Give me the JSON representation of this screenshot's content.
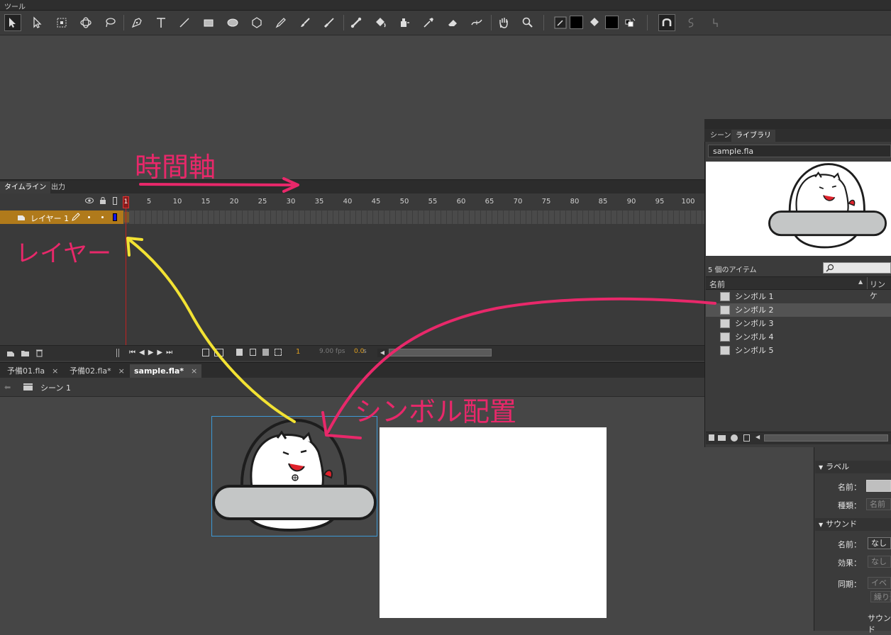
{
  "tools_panel": {
    "title": "ツール"
  },
  "timeline": {
    "tabs": [
      "タイムライン",
      "出力"
    ],
    "ruler_ticks": [
      "1",
      "5",
      "10",
      "15",
      "20",
      "25",
      "30",
      "35",
      "40",
      "45",
      "50",
      "55",
      "60",
      "65",
      "70",
      "75",
      "80",
      "85",
      "90",
      "95",
      "100"
    ],
    "layer_name": "レイヤー 1",
    "footer": {
      "frame": "1",
      "fps": "9.00 fps",
      "seconds": "0.0",
      "sec_unit": "s"
    },
    "colors": {
      "layer_row": "#b07a1b",
      "playhead": "#c02020"
    }
  },
  "document_tabs": [
    {
      "label": "予備01.fla",
      "close": "×"
    },
    {
      "label": "予備02.fla*",
      "close": "×"
    },
    {
      "label": "sample.fla*",
      "close": "×",
      "active": true
    }
  ],
  "scene": {
    "label": "シーン 1"
  },
  "library": {
    "tabs": [
      "シーン",
      "ライブラリ"
    ],
    "file": "sample.fla",
    "item_count": "5 個のアイテム",
    "columns": {
      "name": "名前",
      "linkage": "リンケ"
    },
    "items": [
      "シンボル 1",
      "シンボル 2",
      "シンボル 3",
      "シンボル 4",
      "シンボル 5"
    ],
    "selected_index": 1
  },
  "properties": {
    "label_section": "ラベル",
    "label_name": "名前：",
    "label_type": "種類：",
    "label_type_value": "名前",
    "sound_section": "サウンド",
    "sound_name": "名前：",
    "sound_name_value": "なし",
    "sound_effect": "効果：",
    "sound_effect_value": "なし",
    "sound_sync": "同期：",
    "sound_sync_value": "イベ",
    "sound_repeat_value": "繰り返",
    "sound_footer": "サウンド"
  },
  "annotations": {
    "timeline_axis": "時間軸",
    "layer": "レイヤー",
    "symbol_placement": "シンボル配置",
    "colors": {
      "pink": "#e8286a",
      "yellow": "#f2e233"
    }
  }
}
